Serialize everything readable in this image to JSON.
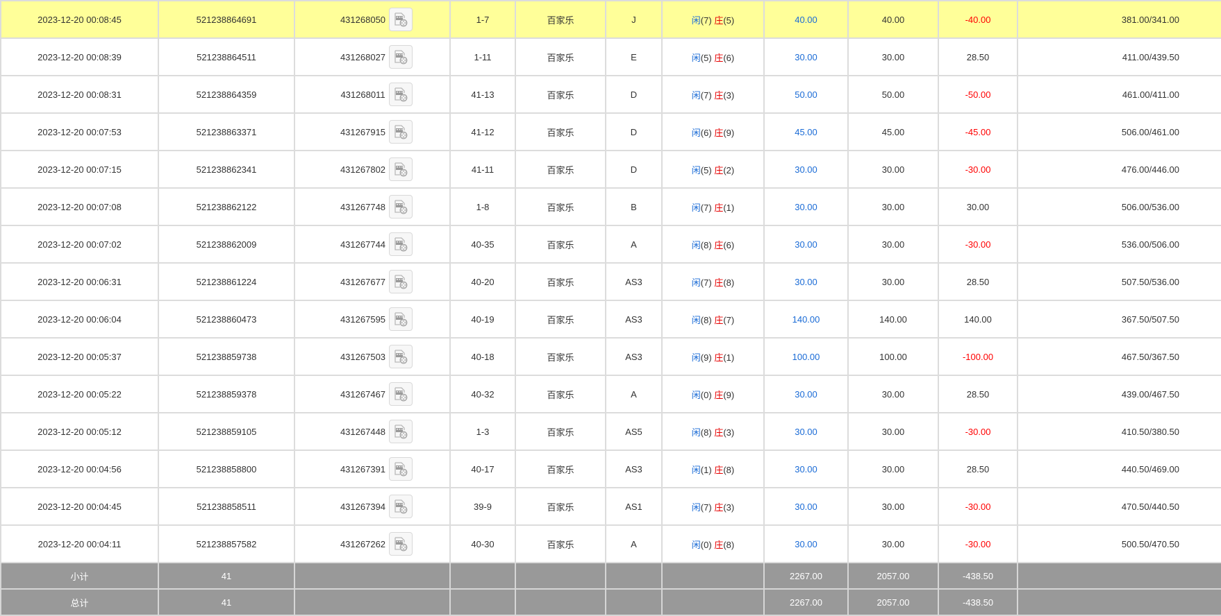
{
  "icon": "video-replay-icon",
  "colors": {
    "highlight_row": "#ffff99",
    "footer_bg": "#999999",
    "amount_blue": "#1a6bd6",
    "negative_red": "#ff0000",
    "border": "#dcdcdc"
  },
  "rows": [
    {
      "time": "2023-12-20 00:08:45",
      "order": "521238864691",
      "game": "431268050",
      "table_no": "1-7",
      "type": "百家乐",
      "bet": "J",
      "p_label": "闲",
      "p_score": "(7)",
      "b_label": "庄",
      "b_score": "(5)",
      "amount": "40.00",
      "valid": "40.00",
      "win": "-40.00",
      "win_neg": true,
      "balance": "381.00/341.00",
      "highlight": true
    },
    {
      "time": "2023-12-20 00:08:39",
      "order": "521238864511",
      "game": "431268027",
      "table_no": "1-11",
      "type": "百家乐",
      "bet": "E",
      "p_label": "闲",
      "p_score": "(5)",
      "b_label": "庄",
      "b_score": "(6)",
      "amount": "30.00",
      "valid": "30.00",
      "win": "28.50",
      "win_neg": false,
      "balance": "411.00/439.50"
    },
    {
      "time": "2023-12-20 00:08:31",
      "order": "521238864359",
      "game": "431268011",
      "table_no": "41-13",
      "type": "百家乐",
      "bet": "D",
      "p_label": "闲",
      "p_score": "(7)",
      "b_label": "庄",
      "b_score": "(3)",
      "amount": "50.00",
      "valid": "50.00",
      "win": "-50.00",
      "win_neg": true,
      "balance": "461.00/411.00"
    },
    {
      "time": "2023-12-20 00:07:53",
      "order": "521238863371",
      "game": "431267915",
      "table_no": "41-12",
      "type": "百家乐",
      "bet": "D",
      "p_label": "闲",
      "p_score": "(6)",
      "b_label": "庄",
      "b_score": "(9)",
      "amount": "45.00",
      "valid": "45.00",
      "win": "-45.00",
      "win_neg": true,
      "balance": "506.00/461.00"
    },
    {
      "time": "2023-12-20 00:07:15",
      "order": "521238862341",
      "game": "431267802",
      "table_no": "41-11",
      "type": "百家乐",
      "bet": "D",
      "p_label": "闲",
      "p_score": "(5)",
      "b_label": "庄",
      "b_score": "(2)",
      "amount": "30.00",
      "valid": "30.00",
      "win": "-30.00",
      "win_neg": true,
      "balance": "476.00/446.00"
    },
    {
      "time": "2023-12-20 00:07:08",
      "order": "521238862122",
      "game": "431267748",
      "table_no": "1-8",
      "type": "百家乐",
      "bet": "B",
      "p_label": "闲",
      "p_score": "(7)",
      "b_label": "庄",
      "b_score": "(1)",
      "amount": "30.00",
      "valid": "30.00",
      "win": "30.00",
      "win_neg": false,
      "balance": "506.00/536.00"
    },
    {
      "time": "2023-12-20 00:07:02",
      "order": "521238862009",
      "game": "431267744",
      "table_no": "40-35",
      "type": "百家乐",
      "bet": "A",
      "p_label": "闲",
      "p_score": "(8)",
      "b_label": "庄",
      "b_score": "(6)",
      "amount": "30.00",
      "valid": "30.00",
      "win": "-30.00",
      "win_neg": true,
      "balance": "536.00/506.00"
    },
    {
      "time": "2023-12-20 00:06:31",
      "order": "521238861224",
      "game": "431267677",
      "table_no": "40-20",
      "type": "百家乐",
      "bet": "AS3",
      "p_label": "闲",
      "p_score": "(7)",
      "b_label": "庄",
      "b_score": "(8)",
      "amount": "30.00",
      "valid": "30.00",
      "win": "28.50",
      "win_neg": false,
      "balance": "507.50/536.00"
    },
    {
      "time": "2023-12-20 00:06:04",
      "order": "521238860473",
      "game": "431267595",
      "table_no": "40-19",
      "type": "百家乐",
      "bet": "AS3",
      "p_label": "闲",
      "p_score": "(8)",
      "b_label": "庄",
      "b_score": "(7)",
      "amount": "140.00",
      "valid": "140.00",
      "win": "140.00",
      "win_neg": false,
      "balance": "367.50/507.50"
    },
    {
      "time": "2023-12-20 00:05:37",
      "order": "521238859738",
      "game": "431267503",
      "table_no": "40-18",
      "type": "百家乐",
      "bet": "AS3",
      "p_label": "闲",
      "p_score": "(9)",
      "b_label": "庄",
      "b_score": "(1)",
      "amount": "100.00",
      "valid": "100.00",
      "win": "-100.00",
      "win_neg": true,
      "balance": "467.50/367.50"
    },
    {
      "time": "2023-12-20 00:05:22",
      "order": "521238859378",
      "game": "431267467",
      "table_no": "40-32",
      "type": "百家乐",
      "bet": "A",
      "p_label": "闲",
      "p_score": "(0)",
      "b_label": "庄",
      "b_score": "(9)",
      "amount": "30.00",
      "valid": "30.00",
      "win": "28.50",
      "win_neg": false,
      "balance": "439.00/467.50"
    },
    {
      "time": "2023-12-20 00:05:12",
      "order": "521238859105",
      "game": "431267448",
      "table_no": "1-3",
      "type": "百家乐",
      "bet": "AS5",
      "p_label": "闲",
      "p_score": "(8)",
      "b_label": "庄",
      "b_score": "(3)",
      "amount": "30.00",
      "valid": "30.00",
      "win": "-30.00",
      "win_neg": true,
      "balance": "410.50/380.50"
    },
    {
      "time": "2023-12-20 00:04:56",
      "order": "521238858800",
      "game": "431267391",
      "table_no": "40-17",
      "type": "百家乐",
      "bet": "AS3",
      "p_label": "闲",
      "p_score": "(1)",
      "b_label": "庄",
      "b_score": "(8)",
      "amount": "30.00",
      "valid": "30.00",
      "win": "28.50",
      "win_neg": false,
      "balance": "440.50/469.00"
    },
    {
      "time": "2023-12-20 00:04:45",
      "order": "521238858511",
      "game": "431267394",
      "table_no": "39-9",
      "type": "百家乐",
      "bet": "AS1",
      "p_label": "闲",
      "p_score": "(7)",
      "b_label": "庄",
      "b_score": "(3)",
      "amount": "30.00",
      "valid": "30.00",
      "win": "-30.00",
      "win_neg": true,
      "balance": "470.50/440.50"
    },
    {
      "time": "2023-12-20 00:04:11",
      "order": "521238857582",
      "game": "431267262",
      "table_no": "40-30",
      "type": "百家乐",
      "bet": "A",
      "p_label": "闲",
      "p_score": "(0)",
      "b_label": "庄",
      "b_score": "(8)",
      "amount": "30.00",
      "valid": "30.00",
      "win": "-30.00",
      "win_neg": true,
      "balance": "500.50/470.50"
    }
  ],
  "subtotal": {
    "label": "小计",
    "count": "41",
    "amount": "2267.00",
    "valid": "2057.00",
    "win": "-438.50"
  },
  "total": {
    "label": "总计",
    "count": "41",
    "amount": "2267.00",
    "valid": "2057.00",
    "win": "-438.50"
  }
}
